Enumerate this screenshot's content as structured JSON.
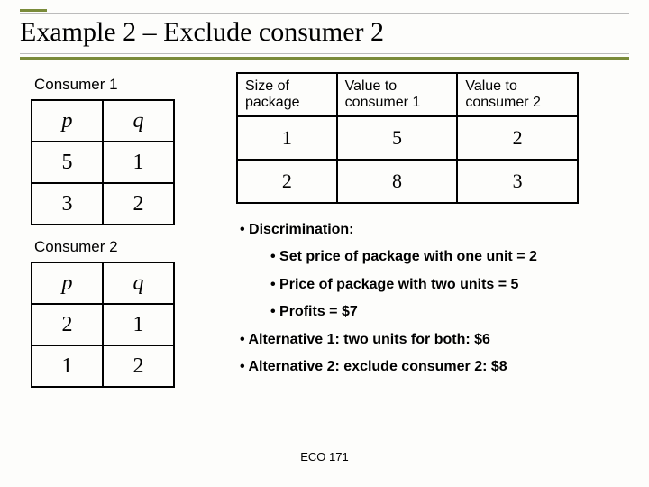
{
  "title": "Example 2 – Exclude consumer 2",
  "consumer1": {
    "label": "Consumer 1",
    "headers": [
      "p",
      "q"
    ],
    "rows": [
      [
        "5",
        "1"
      ],
      [
        "3",
        "2"
      ]
    ]
  },
  "consumer2": {
    "label": "Consumer 2",
    "headers": [
      "p",
      "q"
    ],
    "rows": [
      [
        "2",
        "1"
      ],
      [
        "1",
        "2"
      ]
    ]
  },
  "value_table": {
    "headers": [
      "Size of package",
      "Value to consumer 1",
      "Value to consumer 2"
    ],
    "rows": [
      [
        "1",
        "5",
        "2"
      ],
      [
        "2",
        "8",
        "3"
      ]
    ]
  },
  "bullets": {
    "b1": "• Discrimination:",
    "b2": "• Set price of package with one unit = 2",
    "b3": "• Price of package with two units = 5",
    "b4": "• Profits = $7",
    "b5": "• Alternative 1: two units for both: $6",
    "b6": "• Alternative 2: exclude consumer 2: $8"
  },
  "footer": "ECO 171",
  "chart_data": {
    "type": "table",
    "tables": [
      {
        "title": "Consumer 1",
        "columns": [
          "p",
          "q"
        ],
        "rows": [
          [
            5,
            1
          ],
          [
            3,
            2
          ]
        ]
      },
      {
        "title": "Consumer 2",
        "columns": [
          "p",
          "q"
        ],
        "rows": [
          [
            2,
            1
          ],
          [
            1,
            2
          ]
        ]
      },
      {
        "title": "Package values",
        "columns": [
          "Size of package",
          "Value to consumer 1",
          "Value to consumer 2"
        ],
        "rows": [
          [
            1,
            5,
            2
          ],
          [
            2,
            8,
            3
          ]
        ]
      }
    ]
  }
}
